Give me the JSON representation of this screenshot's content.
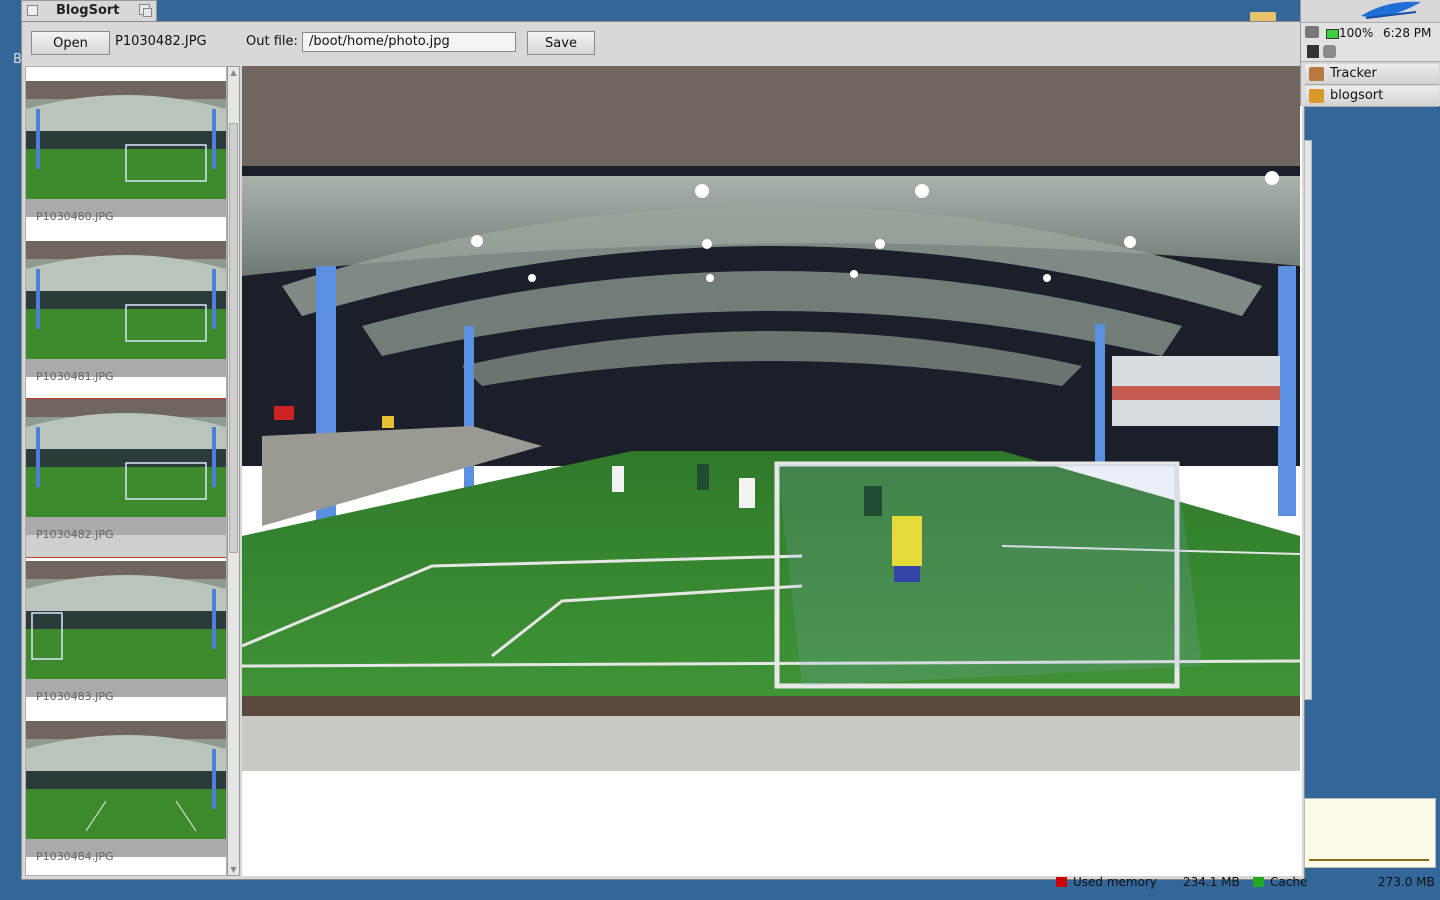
{
  "window": {
    "title": "BlogSort",
    "open_label": "Open",
    "current_file": "P1030482.JPG",
    "out_file_label": "Out file:",
    "out_file_value": "/boot/home/photo.jpg",
    "save_label": "Save"
  },
  "thumbnails": [
    {
      "name": "P1030480.JPG",
      "selected": false
    },
    {
      "name": "P1030481.JPG",
      "selected": false
    },
    {
      "name": "P1030482.JPG",
      "selected": true
    },
    {
      "name": "P1030483.JPG",
      "selected": false
    },
    {
      "name": "P1030484.JPG",
      "selected": false
    }
  ],
  "deskbar": {
    "battery": "100%",
    "clock": "6:28 PM",
    "apps": [
      {
        "label": "Tracker",
        "icon": "tracker-icon"
      },
      {
        "label": "blogsort",
        "icon": "blogsort-app-icon"
      }
    ]
  },
  "background": {
    "used_memory_label": "Used memory",
    "used_memory_value": "234.1 MB",
    "cache_label": "Cache",
    "total_value": "273.0 MB",
    "desktop_letter": "B"
  },
  "colors": {
    "desktop": "#336699",
    "window_chrome": "#d8d8d8",
    "selection": "#c0392b",
    "used_memory": "#cc0000",
    "cache": "#22aa22"
  }
}
